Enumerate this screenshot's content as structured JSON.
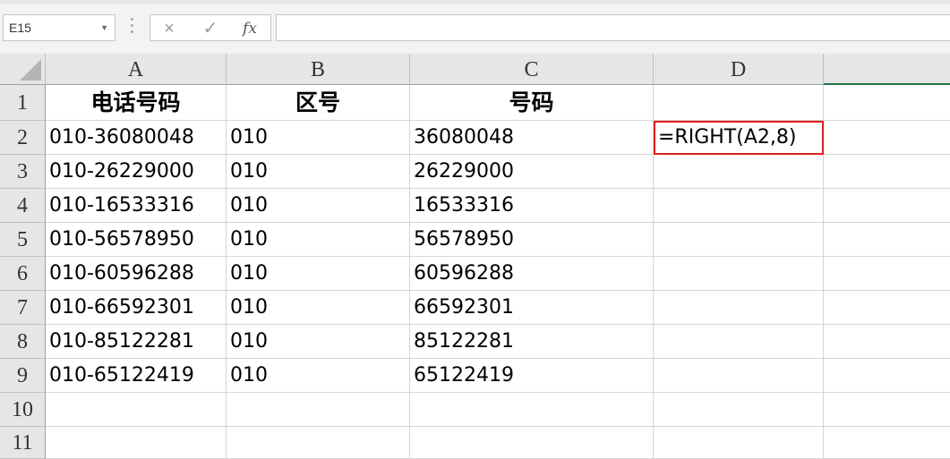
{
  "name_box": "E15",
  "formula_bar": {
    "cancel_icon": "×",
    "enter_icon": "✓",
    "fx_label": "fx",
    "content": ""
  },
  "columns": [
    "A",
    "B",
    "C",
    "D",
    ""
  ],
  "rows": [
    "1",
    "2",
    "3",
    "4",
    "5",
    "6",
    "7",
    "8",
    "9",
    "10",
    "11"
  ],
  "cells": {
    "header": [
      "电话号码",
      "区号",
      "号码"
    ],
    "data": [
      [
        "010-36080048",
        "010",
        "36080048"
      ],
      [
        "010-26229000",
        "010",
        "26229000"
      ],
      [
        "010-16533316",
        "010",
        "16533316"
      ],
      [
        "010-56578950",
        "010",
        "56578950"
      ],
      [
        "010-60596288",
        "010",
        "60596288"
      ],
      [
        "010-66592301",
        "010",
        "66592301"
      ],
      [
        "010-85122281",
        "010",
        "85122281"
      ],
      [
        "010-65122419",
        "010",
        "65122419"
      ]
    ],
    "d2": "=RIGHT(A2,8)"
  },
  "colors": {
    "highlight_border": "#e02020",
    "selected_column_accent": "#217346"
  }
}
